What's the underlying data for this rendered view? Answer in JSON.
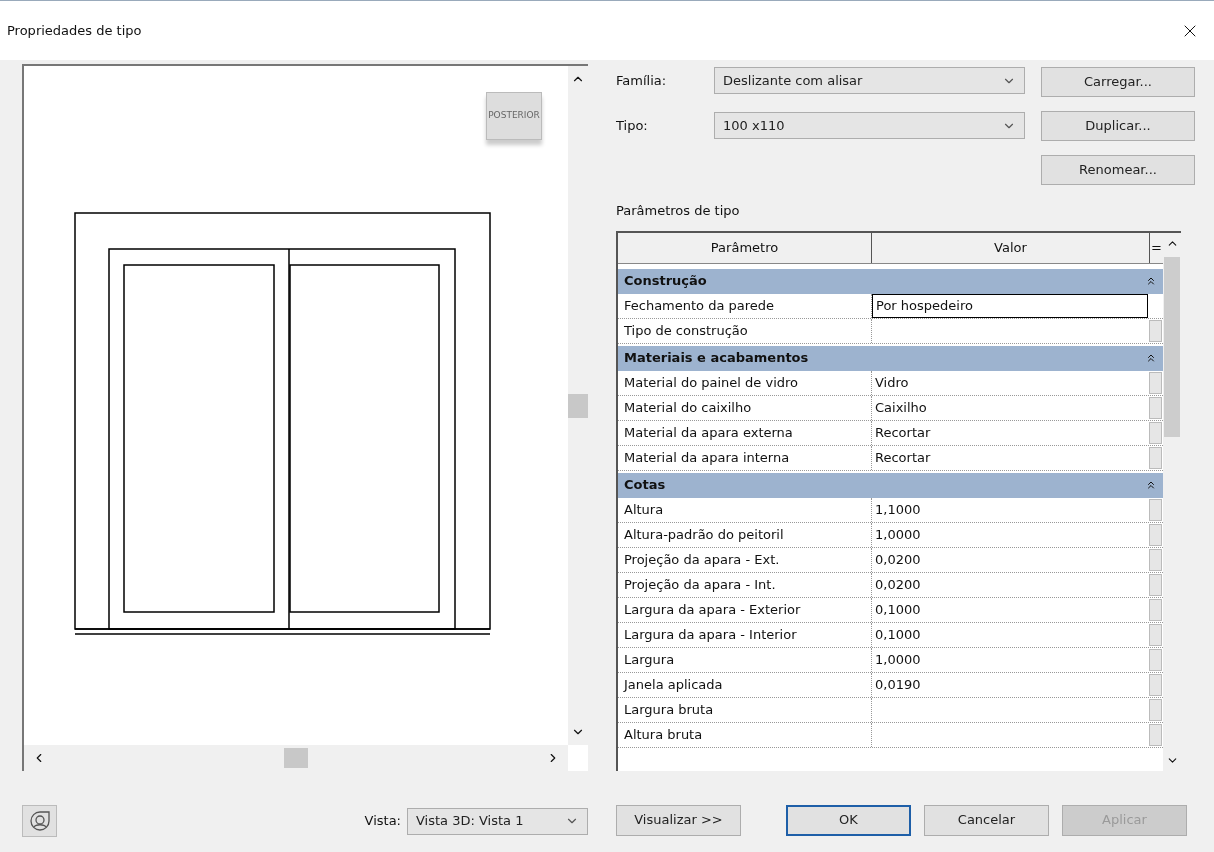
{
  "window": {
    "title": "Propriedades de tipo"
  },
  "preview": {
    "viewcube_label": "POSTERIOR",
    "vista_label": "Vista:",
    "vista_value": "Vista 3D: Vista 1"
  },
  "family": {
    "label": "Família:",
    "value": "Deslizante com alisar"
  },
  "type": {
    "label": "Tipo:",
    "value": "100 x110"
  },
  "side_buttons": [
    "Carregar...",
    "Duplicar...",
    "Renomear..."
  ],
  "table": {
    "caption": "Parâmetros de tipo",
    "columns": [
      "Parâmetro",
      "Valor"
    ],
    "eq_button": "=",
    "rows": [
      {
        "kind": "group",
        "name": "Construção",
        "expanded": true
      },
      {
        "kind": "param",
        "name": "Fechamento da parede",
        "value": "Por hospedeiro",
        "selected": true
      },
      {
        "kind": "param",
        "name": "Tipo de construção",
        "selected": false
      },
      {
        "kind": "group",
        "name": "Materiais e acabamentos",
        "expanded": true
      },
      {
        "kind": "param",
        "name": "Material do painel de vidro",
        "value": "Vidro",
        "selected": false
      },
      {
        "kind": "param",
        "name": "Material do caixilho",
        "value": "Caixilho",
        "selected": false
      },
      {
        "kind": "param",
        "name": "Material da apara externa",
        "value": "Recortar",
        "selected": false
      },
      {
        "kind": "param",
        "name": "Material da apara interna",
        "value": "Recortar",
        "selected": false
      },
      {
        "kind": "group",
        "name": "Cotas",
        "expanded": true
      },
      {
        "kind": "param",
        "name": "Altura",
        "value": "1,1000",
        "selected": false
      },
      {
        "kind": "param",
        "name": "Altura-padrão do peitoril",
        "value": "1,0000",
        "selected": false
      },
      {
        "kind": "param",
        "name": "Projeção da apara - Ext.",
        "value": "0,0200",
        "selected": false
      },
      {
        "kind": "param",
        "name": "Projeção da apara - Int.",
        "value": "0,0200",
        "selected": false
      },
      {
        "kind": "param",
        "name": "Largura da apara - Exterior",
        "value": "0,1000",
        "selected": false
      },
      {
        "kind": "param",
        "name": "Largura da apara - Interior",
        "value": "0,1000",
        "selected": false
      },
      {
        "kind": "param",
        "name": "Largura",
        "value": "1,0000",
        "selected": false
      },
      {
        "kind": "param",
        "name": "Janela aplicada",
        "value": "0,0190",
        "selected": false
      },
      {
        "kind": "param",
        "name": "Largura bruta",
        "selected": false
      },
      {
        "kind": "param",
        "name": "Altura bruta",
        "selected": false
      }
    ]
  },
  "footer_buttons": [
    {
      "label": "Visualizar >>",
      "kind": "normal",
      "disabled": false
    },
    {
      "label": "OK",
      "kind": "default",
      "disabled": false
    },
    {
      "label": "Cancelar",
      "kind": "normal",
      "disabled": false
    },
    {
      "label": "Aplicar",
      "kind": "normal",
      "disabled": true
    }
  ]
}
